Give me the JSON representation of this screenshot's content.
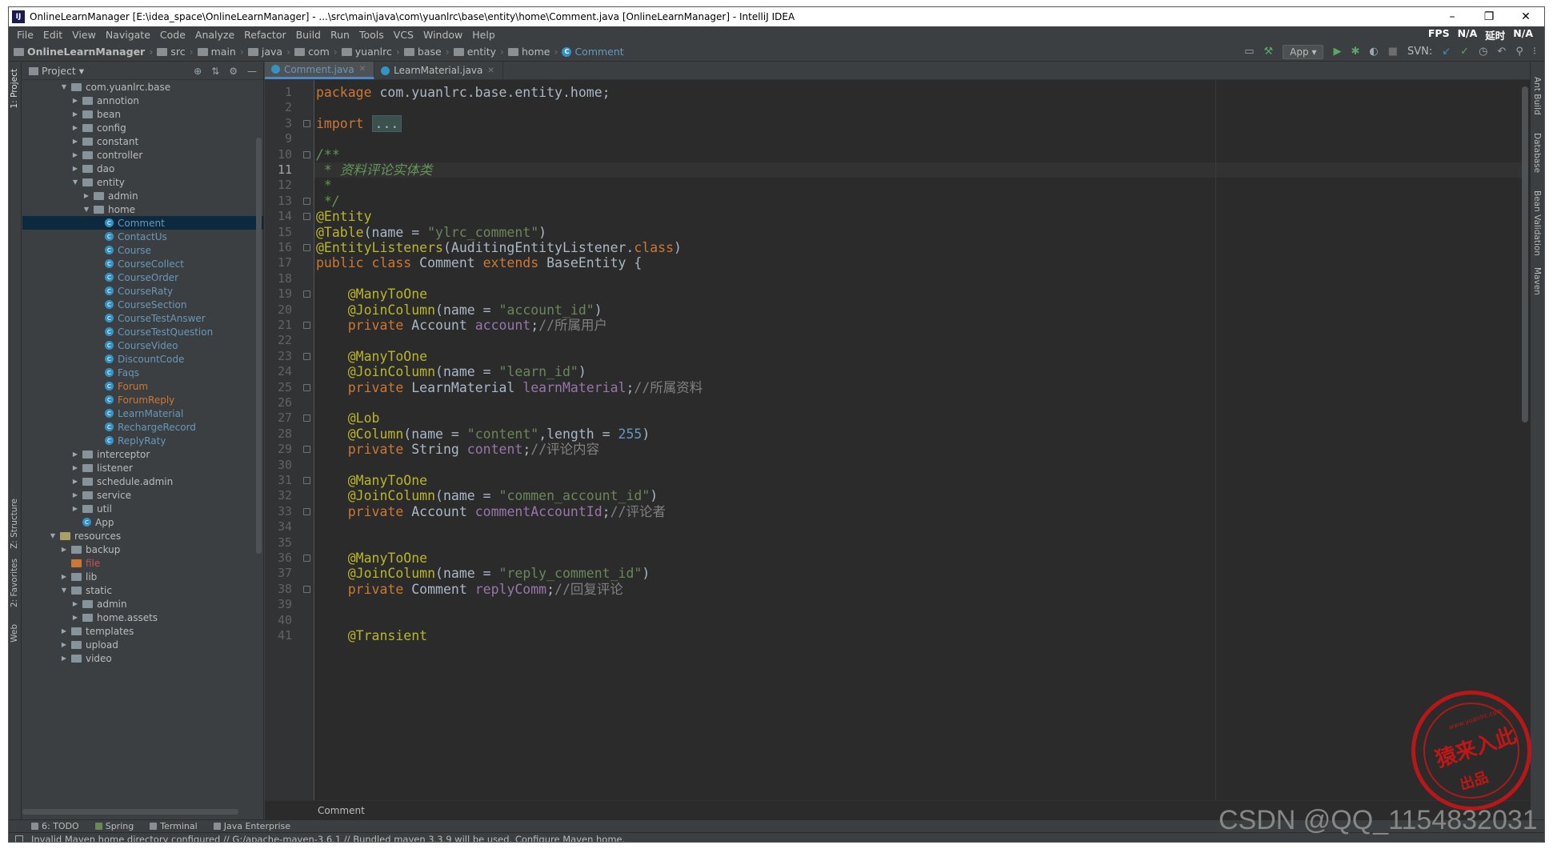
{
  "window": {
    "title": "OnlineLearnManager [E:\\idea_space\\OnlineLearnManager] - ...\\src\\main\\java\\com\\yuanlrc\\base\\entity\\home\\Comment.java [OnlineLearnManager] - IntelliJ IDEA",
    "minimize": "–",
    "maximize": "❐",
    "close": "✕"
  },
  "menu": {
    "items": [
      "File",
      "Edit",
      "View",
      "Navigate",
      "Code",
      "Analyze",
      "Refactor",
      "Build",
      "Run",
      "Tools",
      "VCS",
      "Window",
      "Help"
    ],
    "fps_label": "FPS",
    "fps_value": "N/A",
    "latency_label": "延时",
    "latency_value": "N/A"
  },
  "navbar": {
    "crumbs": [
      "OnlineLearnManager",
      "src",
      "main",
      "java",
      "com",
      "yuanlrc",
      "base",
      "entity",
      "home",
      "Comment"
    ],
    "run_config": "App",
    "svn_label": "SVN:"
  },
  "left_strip": {
    "project": "1: Project",
    "structure": "Z: Structure",
    "favorites": "2: Favorites",
    "web": "Web"
  },
  "right_strip": {
    "ant": "Ant Build",
    "database": "Database",
    "bean": "Bean Validation",
    "maven": "Maven"
  },
  "project": {
    "title": "Project",
    "tree": [
      {
        "label": "com.yuanlrc.base",
        "depth": 4,
        "arrow": "▼",
        "icon": "pkg",
        "style": ""
      },
      {
        "label": "annotion",
        "depth": 5,
        "arrow": "▶",
        "icon": "pkg",
        "style": ""
      },
      {
        "label": "bean",
        "depth": 5,
        "arrow": "▶",
        "icon": "pkg",
        "style": ""
      },
      {
        "label": "config",
        "depth": 5,
        "arrow": "▶",
        "icon": "pkg",
        "style": ""
      },
      {
        "label": "constant",
        "depth": 5,
        "arrow": "▶",
        "icon": "pkg",
        "style": ""
      },
      {
        "label": "controller",
        "depth": 5,
        "arrow": "▶",
        "icon": "pkg",
        "style": ""
      },
      {
        "label": "dao",
        "depth": 5,
        "arrow": "▶",
        "icon": "pkg",
        "style": ""
      },
      {
        "label": "entity",
        "depth": 5,
        "arrow": "▼",
        "icon": "pkg",
        "style": ""
      },
      {
        "label": "admin",
        "depth": 6,
        "arrow": "▶",
        "icon": "pkg",
        "style": ""
      },
      {
        "label": "home",
        "depth": 6,
        "arrow": "▼",
        "icon": "pkg",
        "style": ""
      },
      {
        "label": "Comment",
        "depth": 7,
        "arrow": "",
        "icon": "class",
        "style": "blue",
        "selected": true
      },
      {
        "label": "ContactUs",
        "depth": 7,
        "arrow": "",
        "icon": "class",
        "style": "blue"
      },
      {
        "label": "Course",
        "depth": 7,
        "arrow": "",
        "icon": "class",
        "style": "blue"
      },
      {
        "label": "CourseCollect",
        "depth": 7,
        "arrow": "",
        "icon": "class",
        "style": "blue"
      },
      {
        "label": "CourseOrder",
        "depth": 7,
        "arrow": "",
        "icon": "class",
        "style": "blue"
      },
      {
        "label": "CourseRaty",
        "depth": 7,
        "arrow": "",
        "icon": "class",
        "style": "blue"
      },
      {
        "label": "CourseSection",
        "depth": 7,
        "arrow": "",
        "icon": "class",
        "style": "blue"
      },
      {
        "label": "CourseTestAnswer",
        "depth": 7,
        "arrow": "",
        "icon": "class",
        "style": "blue"
      },
      {
        "label": "CourseTestQuestion",
        "depth": 7,
        "arrow": "",
        "icon": "class",
        "style": "blue"
      },
      {
        "label": "CourseVideo",
        "depth": 7,
        "arrow": "",
        "icon": "class",
        "style": "blue"
      },
      {
        "label": "DiscountCode",
        "depth": 7,
        "arrow": "",
        "icon": "class",
        "style": "blue"
      },
      {
        "label": "Faqs",
        "depth": 7,
        "arrow": "",
        "icon": "class",
        "style": "blue"
      },
      {
        "label": "Forum",
        "depth": 7,
        "arrow": "",
        "icon": "class",
        "style": "orange"
      },
      {
        "label": "ForumReply",
        "depth": 7,
        "arrow": "",
        "icon": "class",
        "style": "orange"
      },
      {
        "label": "LearnMaterial",
        "depth": 7,
        "arrow": "",
        "icon": "class",
        "style": "blue"
      },
      {
        "label": "RechargeRecord",
        "depth": 7,
        "arrow": "",
        "icon": "class",
        "style": "blue"
      },
      {
        "label": "ReplyRaty",
        "depth": 7,
        "arrow": "",
        "icon": "class",
        "style": "blue"
      },
      {
        "label": "interceptor",
        "depth": 5,
        "arrow": "▶",
        "icon": "pkg",
        "style": ""
      },
      {
        "label": "listener",
        "depth": 5,
        "arrow": "▶",
        "icon": "pkg",
        "style": ""
      },
      {
        "label": "schedule.admin",
        "depth": 5,
        "arrow": "▶",
        "icon": "pkg",
        "style": ""
      },
      {
        "label": "service",
        "depth": 5,
        "arrow": "▶",
        "icon": "pkg",
        "style": ""
      },
      {
        "label": "util",
        "depth": 5,
        "arrow": "▶",
        "icon": "pkg",
        "style": ""
      },
      {
        "label": "App",
        "depth": 5,
        "arrow": "",
        "icon": "class",
        "style": ""
      },
      {
        "label": "resources",
        "depth": 3,
        "arrow": "▼",
        "icon": "res",
        "style": ""
      },
      {
        "label": "backup",
        "depth": 4,
        "arrow": "▶",
        "icon": "pkg",
        "style": ""
      },
      {
        "label": "file",
        "depth": 4,
        "arrow": "",
        "icon": "file",
        "style": "red"
      },
      {
        "label": "lib",
        "depth": 4,
        "arrow": "▶",
        "icon": "pkg",
        "style": ""
      },
      {
        "label": "static",
        "depth": 4,
        "arrow": "▼",
        "icon": "pkg",
        "style": ""
      },
      {
        "label": "admin",
        "depth": 5,
        "arrow": "▶",
        "icon": "pkg",
        "style": ""
      },
      {
        "label": "home.assets",
        "depth": 5,
        "arrow": "▶",
        "icon": "pkg",
        "style": ""
      },
      {
        "label": "templates",
        "depth": 4,
        "arrow": "▶",
        "icon": "pkg",
        "style": ""
      },
      {
        "label": "upload",
        "depth": 4,
        "arrow": "▶",
        "icon": "pkg",
        "style": ""
      },
      {
        "label": "video",
        "depth": 4,
        "arrow": "▶",
        "icon": "pkg",
        "style": ""
      }
    ]
  },
  "editor": {
    "tabs": [
      {
        "label": "Comment.java",
        "active": true
      },
      {
        "label": "LearnMaterial.java",
        "active": false
      }
    ],
    "current_line": "11",
    "lines": [
      {
        "no": "1",
        "html": "<span class='kw'>package</span> com.yuanlrc.base.entity.home;"
      },
      {
        "no": "2",
        "html": ""
      },
      {
        "no": "3",
        "html": "<span class='kw'>import</span> <span class='folded'>...</span>",
        "fold": true
      },
      {
        "no": "9",
        "html": ""
      },
      {
        "no": "10",
        "html": "<span class='doc'>/**</span>",
        "fold": true
      },
      {
        "no": "11",
        "html": "<span class='doc'> * 资料评论实体类</span>"
      },
      {
        "no": "12",
        "html": "<span class='doc'> *</span>"
      },
      {
        "no": "13",
        "html": "<span class='doc'> */</span>",
        "fold": true
      },
      {
        "no": "14",
        "html": "<span class='ann'>@Entity</span>",
        "fold": true
      },
      {
        "no": "15",
        "html": "<span class='ann'>@Table</span>(name = <span class='str'>\"ylrc_comment\"</span>)"
      },
      {
        "no": "16",
        "html": "<span class='ann'>@EntityListeners</span>(AuditingEntityListener.<span class='kw'>class</span>)",
        "fold": true
      },
      {
        "no": "17",
        "html": "<span class='kw'>public class</span> Comment <span class='kw'>extends</span> BaseEntity {"
      },
      {
        "no": "18",
        "html": ""
      },
      {
        "no": "19",
        "html": "    <span class='ann'>@ManyToOne</span>",
        "fold": true
      },
      {
        "no": "20",
        "html": "    <span class='ann'>@JoinColumn</span>(name = <span class='str'>\"account_id\"</span>)"
      },
      {
        "no": "21",
        "html": "    <span class='kw'>private</span> Account <span class='fld'>account</span>;<span class='cmt'>//所属用户</span>",
        "fold": true
      },
      {
        "no": "22",
        "html": ""
      },
      {
        "no": "23",
        "html": "    <span class='ann'>@ManyToOne</span>",
        "fold": true
      },
      {
        "no": "24",
        "html": "    <span class='ann'>@JoinColumn</span>(name = <span class='str'>\"learn_id\"</span>)"
      },
      {
        "no": "25",
        "html": "    <span class='kw'>private</span> LearnMaterial <span class='fld'>learnMaterial</span>;<span class='cmt'>//所属资料</span>",
        "fold": true
      },
      {
        "no": "26",
        "html": ""
      },
      {
        "no": "27",
        "html": "    <span class='ann'>@Lob</span>",
        "fold": true
      },
      {
        "no": "28",
        "html": "    <span class='ann'>@Column</span>(name = <span class='str'>\"content\"</span>,length = <span class='num'>255</span>)"
      },
      {
        "no": "29",
        "html": "    <span class='kw'>private</span> String <span class='fld'>content</span>;<span class='cmt'>//评论内容</span>",
        "fold": true
      },
      {
        "no": "30",
        "html": ""
      },
      {
        "no": "31",
        "html": "    <span class='ann'>@ManyToOne</span>",
        "fold": true
      },
      {
        "no": "32",
        "html": "    <span class='ann'>@JoinColumn</span>(name = <span class='str'>\"commen_account_id\"</span>)"
      },
      {
        "no": "33",
        "html": "    <span class='kw'>private</span> Account <span class='fld'>commentAccountId</span>;<span class='cmt'>//评论者</span>",
        "fold": true
      },
      {
        "no": "34",
        "html": ""
      },
      {
        "no": "35",
        "html": ""
      },
      {
        "no": "36",
        "html": "    <span class='ann'>@ManyToOne</span>",
        "fold": true
      },
      {
        "no": "37",
        "html": "    <span class='ann'>@JoinColumn</span>(name = <span class='str'>\"reply_comment_id\"</span>)"
      },
      {
        "no": "38",
        "html": "    <span class='kw'>private</span> Comment <span class='fld'>replyComm</span>;<span class='cmt'>//回复评论</span>",
        "fold": true
      },
      {
        "no": "39",
        "html": ""
      },
      {
        "no": "40",
        "html": ""
      },
      {
        "no": "41",
        "html": "    <span class='ann'>@Transient</span>"
      }
    ],
    "breadcrumb": "Comment"
  },
  "bottom_tabs": [
    "6: TODO",
    "Spring",
    "Terminal",
    "Java Enterprise"
  ],
  "status": {
    "message": "Invalid Maven home directory configured // G:/apache-maven-3.6.1 // Bundled maven 3.3.9 will be used.  Configure Maven home."
  },
  "watermark": {
    "text": "CSDN @QQ_1154832031",
    "seal_main": "猿来入此",
    "seal_sub": "出品",
    "seal_url": "www.yuanlrc.com"
  }
}
